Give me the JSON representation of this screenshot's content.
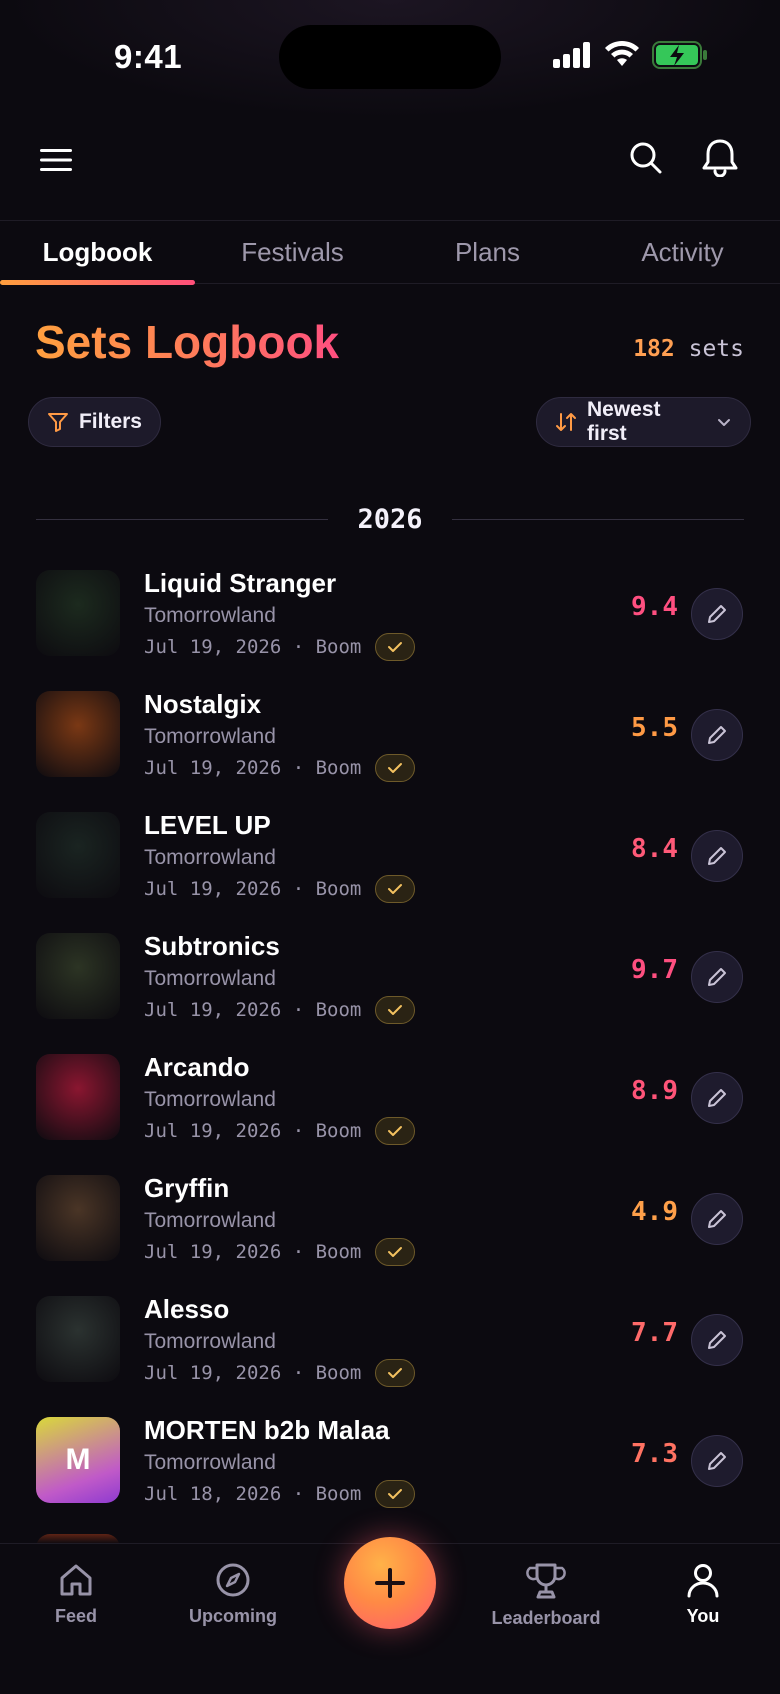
{
  "status": {
    "time": "9:41"
  },
  "tabs": [
    {
      "label": "Logbook",
      "active": true
    },
    {
      "label": "Festivals",
      "active": false
    },
    {
      "label": "Plans",
      "active": false
    },
    {
      "label": "Activity",
      "active": false
    }
  ],
  "header": {
    "title": "Sets Logbook",
    "count_number": "182",
    "count_unit": "sets"
  },
  "controls": {
    "filters_label": "Filters",
    "sort_label": "Newest first"
  },
  "year_label": "2026",
  "sets": [
    {
      "artist": "Liquid Stranger",
      "festival": "Tomorrowland",
      "date": "Jul 19, 2026",
      "stage": "Boom",
      "score": "9.4",
      "score_color": "#ff4f80",
      "avatar_bg": "#1c2a1e"
    },
    {
      "artist": "Nostalgix",
      "festival": "Tomorrowland",
      "date": "Jul 19, 2026",
      "stage": "Boom",
      "score": "5.5",
      "score_color": "#ff9a45",
      "avatar_bg": "#7a3814"
    },
    {
      "artist": "LEVEL UP",
      "festival": "Tomorrowland",
      "date": "Jul 19, 2026",
      "stage": "Boom",
      "score": "8.4",
      "score_color": "#ff5a78",
      "avatar_bg": "#1a2421"
    },
    {
      "artist": "Subtronics",
      "festival": "Tomorrowland",
      "date": "Jul 19, 2026",
      "stage": "Boom",
      "score": "9.7",
      "score_color": "#ff4f80",
      "avatar_bg": "#2c3424"
    },
    {
      "artist": "Arcando",
      "festival": "Tomorrowland",
      "date": "Jul 19, 2026",
      "stage": "Boom",
      "score": "8.9",
      "score_color": "#ff5478",
      "avatar_bg": "#8a1630"
    },
    {
      "artist": "Gryffin",
      "festival": "Tomorrowland",
      "date": "Jul 19, 2026",
      "stage": "Boom",
      "score": "4.9",
      "score_color": "#ffa04a",
      "avatar_bg": "#4a3526"
    },
    {
      "artist": "Alesso",
      "festival": "Tomorrowland",
      "date": "Jul 19, 2026",
      "stage": "Boom",
      "score": "7.7",
      "score_color": "#ff6a6a",
      "avatar_bg": "#2b3230"
    },
    {
      "artist": "MORTEN b2b Malaa",
      "festival": "Tomorrowland",
      "date": "Jul 18, 2026",
      "stage": "Boom",
      "score": "7.3",
      "score_color": "#ff7262",
      "avatar_letter": "M"
    }
  ],
  "nav": [
    {
      "label": "Feed",
      "icon": "home-icon"
    },
    {
      "label": "Upcoming",
      "icon": "compass-icon"
    },
    {
      "label": "Leaderboard",
      "icon": "trophy-icon"
    },
    {
      "label": "You",
      "icon": "user-icon",
      "active": true
    }
  ],
  "colors": {
    "accent_orange": "#ff9f3e",
    "accent_pink": "#ff4f7a",
    "background": "#0c0a10"
  }
}
